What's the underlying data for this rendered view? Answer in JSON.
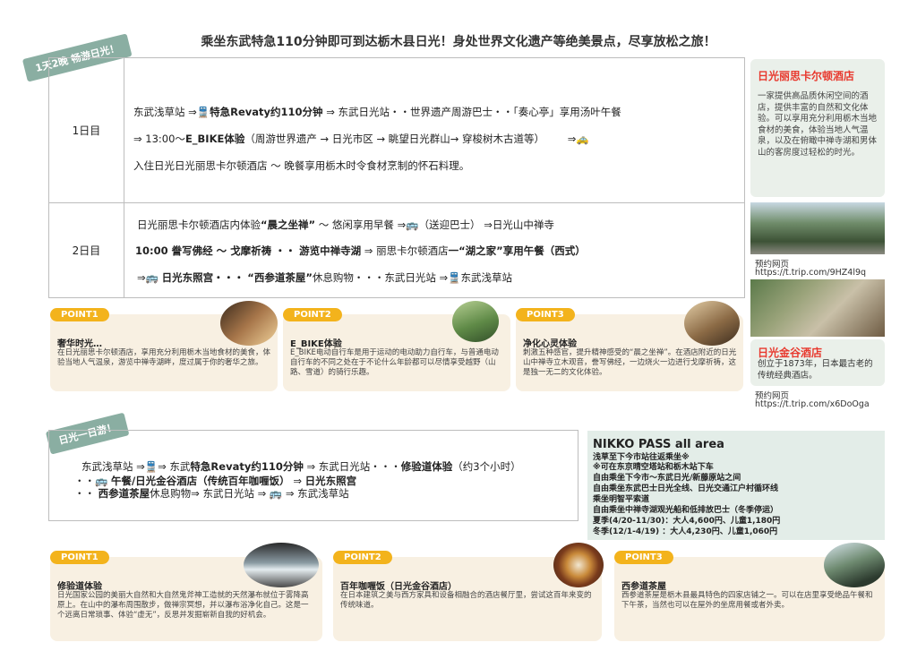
{
  "headline": "乘坐东武特急110分钟即可到达栃木县日光！身处世界文化遗产等绝美景点，尽享放松之旅！",
  "ribbon1": "1天2晚 畅游日光！",
  "ribbon2": "日光一日游！",
  "day1": {
    "label": "1日目",
    "line1_a": "东武浅草站 ⇒",
    "line1_b": "特急Revaty约110分钟",
    "line1_c": "⇒ 东武日光站・・世界遗产周游巴士・・「奏心亭」享用汤叶午餐",
    "line2_a": "⇒ 13:00～",
    "line2_b": "E_BIKE体验",
    "line2_c": "（周游世界遗产 → 日光市区 → 眺望日光群山→ 穿梭树木古道等）",
    "line3": "入住日光日光丽思卡尔顿酒店 ～ 晚餐享用栃木时令食材烹制的怀石料理。"
  },
  "day2": {
    "label": "2日目",
    "line1_a": "日光丽思卡尔顿酒店内体验",
    "line1_b": "“晨之坐禅”",
    "line1_c": "～ 悠闲享用早餐 ⇒",
    "line1_d": "（送迎巴士） ⇒日光山中禅寺",
    "line2_a": "10:00 誊写佛经 ～ 戈摩祈祷 ・・ 游览中禅寺湖",
    "line2_b": "⇒ 丽思卡尔顿酒店",
    "line2_c": "一“湖之家”享用午餐（西式）",
    "line3_a": "⇒",
    "line3_b": "日光东照宫・・・",
    "line3_c": "“西参道茶屋”",
    "line3_d": "休息购物・・・东武日光站 ⇒",
    "line3_e": "东武浅草站"
  },
  "points_top": [
    {
      "badge": "POINT1",
      "title": "奢华时光…",
      "text": "在日光丽思卡尔顿酒店，享用充分利用栃木当地食材的美食，体验当地人气温泉，游览中禅寺湖畔，度过属于你的奢华之旅。"
    },
    {
      "badge": "POINT2",
      "title": "E_BIKE体验",
      "text": "E_BIKE电动自行车是用于运动的电动助力自行车，与普通电动自行车的不同之处在于不论什么年龄都可以尽情享受越野（山路、雪道）的骑行乐趣。"
    },
    {
      "badge": "POINT3",
      "title": "净化心灵体验",
      "text": "刺激五种感官，提升精神感受的“晨之坐禅”。在酒店附近的日光山中禅寺立木观音，誊写佛经，一边烧火一边进行戈摩祈祷，这是独一无二的文化体验。"
    }
  ],
  "hotel1": {
    "name": "日光丽思卡尔顿酒店",
    "desc": "一家提供高品质休闲空间的酒店，提供丰富的自然和文化体验。可以享用充分利用栃木当地食材的美食，体验当地人气温泉，以及在俯瞰中禅寺湖和男体山的客房度过轻松的时光。",
    "url_label": "预约网页",
    "url": "https://t.trip.com/9HZ4l9q"
  },
  "hotel2": {
    "name": "日光金谷酒店",
    "desc": "创立于1873年，日本最古老的传统经典酒店。",
    "url_label": "预约网页",
    "url": "https://t.trip.com/x6DoOga"
  },
  "oneday": {
    "line1_a": "东武浅草站 ⇒",
    "line1_b": "⇒ 东武",
    "line1_c": "特急Revaty约110分钟",
    "line1_d": "⇒ 东武日光站・・・",
    "line1_e": "修验道体验",
    "line1_f": "（约3个小时）",
    "line2_a": "・・",
    "line2_b": "午餐/日光金谷酒店（传统百年咖喱饭）",
    "line2_c": "⇒",
    "line2_d": "日光东照宫",
    "line3_a": "・・",
    "line3_b": "西参道茶屋",
    "line3_c": "休息购物⇒ 东武日光站 ⇒",
    "line3_d": "⇒ 东武浅草站"
  },
  "pass": {
    "title": "NIKKO PASS all area",
    "lines": [
      "浅草至下今市站往返乘坐※",
      "※可在东京晴空塔站和栃木站下车",
      "自由乘坐下今市～东武日光/新藤原站之间",
      "自由乘坐东武巴士日光全线、日光交通江户村循环线",
      "乘坐明智平索道",
      "自由乘坐中禅寺湖观光船和低排放巴士（冬季停运）",
      "夏季(4/20-11/30)：大人4,600円、儿童1,180円",
      "冬季(12/1-4/19) ：大人4,230円、儿童1,060円"
    ]
  },
  "points_bottom": [
    {
      "badge": "POINT1",
      "title": "修验道体验",
      "text": "日光国家公园的美丽大自然和大自然鬼斧神工造就的天然瀑布就位于雾降高原上。在山中的瀑布周围散步，做禅宗冥想，并以瀑布浴净化自己。这是一个远离日常琐事、体验“虚无”，反思并发掘崭新自我的好机会。"
    },
    {
      "badge": "POINT2",
      "title": "百年咖喱饭（日光金谷酒店）",
      "text": "在日本建筑之美与西方家具和设备相融合的酒店餐厅里，尝试这百年来变的传统味道。"
    },
    {
      "badge": "POINT3",
      "title": "西参道茶屋",
      "text": "西参道茶屋是栃木县最具特色的四家店铺之一。可以在店里享受绝品午餐和下午茶，当然也可以在屋外的坐席用餐或者外卖。"
    }
  ]
}
